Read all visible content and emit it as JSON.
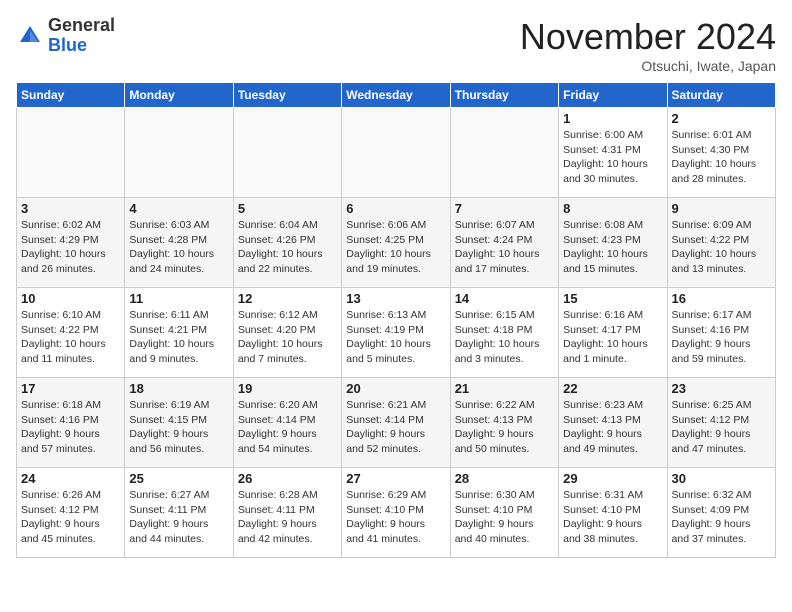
{
  "header": {
    "logo_general": "General",
    "logo_blue": "Blue",
    "month_title": "November 2024",
    "location": "Otsuchi, Iwate, Japan"
  },
  "weekdays": [
    "Sunday",
    "Monday",
    "Tuesday",
    "Wednesday",
    "Thursday",
    "Friday",
    "Saturday"
  ],
  "weeks": [
    [
      {
        "day": "",
        "info": ""
      },
      {
        "day": "",
        "info": ""
      },
      {
        "day": "",
        "info": ""
      },
      {
        "day": "",
        "info": ""
      },
      {
        "day": "",
        "info": ""
      },
      {
        "day": "1",
        "info": "Sunrise: 6:00 AM\nSunset: 4:31 PM\nDaylight: 10 hours\nand 30 minutes."
      },
      {
        "day": "2",
        "info": "Sunrise: 6:01 AM\nSunset: 4:30 PM\nDaylight: 10 hours\nand 28 minutes."
      }
    ],
    [
      {
        "day": "3",
        "info": "Sunrise: 6:02 AM\nSunset: 4:29 PM\nDaylight: 10 hours\nand 26 minutes."
      },
      {
        "day": "4",
        "info": "Sunrise: 6:03 AM\nSunset: 4:28 PM\nDaylight: 10 hours\nand 24 minutes."
      },
      {
        "day": "5",
        "info": "Sunrise: 6:04 AM\nSunset: 4:26 PM\nDaylight: 10 hours\nand 22 minutes."
      },
      {
        "day": "6",
        "info": "Sunrise: 6:06 AM\nSunset: 4:25 PM\nDaylight: 10 hours\nand 19 minutes."
      },
      {
        "day": "7",
        "info": "Sunrise: 6:07 AM\nSunset: 4:24 PM\nDaylight: 10 hours\nand 17 minutes."
      },
      {
        "day": "8",
        "info": "Sunrise: 6:08 AM\nSunset: 4:23 PM\nDaylight: 10 hours\nand 15 minutes."
      },
      {
        "day": "9",
        "info": "Sunrise: 6:09 AM\nSunset: 4:22 PM\nDaylight: 10 hours\nand 13 minutes."
      }
    ],
    [
      {
        "day": "10",
        "info": "Sunrise: 6:10 AM\nSunset: 4:22 PM\nDaylight: 10 hours\nand 11 minutes."
      },
      {
        "day": "11",
        "info": "Sunrise: 6:11 AM\nSunset: 4:21 PM\nDaylight: 10 hours\nand 9 minutes."
      },
      {
        "day": "12",
        "info": "Sunrise: 6:12 AM\nSunset: 4:20 PM\nDaylight: 10 hours\nand 7 minutes."
      },
      {
        "day": "13",
        "info": "Sunrise: 6:13 AM\nSunset: 4:19 PM\nDaylight: 10 hours\nand 5 minutes."
      },
      {
        "day": "14",
        "info": "Sunrise: 6:15 AM\nSunset: 4:18 PM\nDaylight: 10 hours\nand 3 minutes."
      },
      {
        "day": "15",
        "info": "Sunrise: 6:16 AM\nSunset: 4:17 PM\nDaylight: 10 hours\nand 1 minute."
      },
      {
        "day": "16",
        "info": "Sunrise: 6:17 AM\nSunset: 4:16 PM\nDaylight: 9 hours\nand 59 minutes."
      }
    ],
    [
      {
        "day": "17",
        "info": "Sunrise: 6:18 AM\nSunset: 4:16 PM\nDaylight: 9 hours\nand 57 minutes."
      },
      {
        "day": "18",
        "info": "Sunrise: 6:19 AM\nSunset: 4:15 PM\nDaylight: 9 hours\nand 56 minutes."
      },
      {
        "day": "19",
        "info": "Sunrise: 6:20 AM\nSunset: 4:14 PM\nDaylight: 9 hours\nand 54 minutes."
      },
      {
        "day": "20",
        "info": "Sunrise: 6:21 AM\nSunset: 4:14 PM\nDaylight: 9 hours\nand 52 minutes."
      },
      {
        "day": "21",
        "info": "Sunrise: 6:22 AM\nSunset: 4:13 PM\nDaylight: 9 hours\nand 50 minutes."
      },
      {
        "day": "22",
        "info": "Sunrise: 6:23 AM\nSunset: 4:13 PM\nDaylight: 9 hours\nand 49 minutes."
      },
      {
        "day": "23",
        "info": "Sunrise: 6:25 AM\nSunset: 4:12 PM\nDaylight: 9 hours\nand 47 minutes."
      }
    ],
    [
      {
        "day": "24",
        "info": "Sunrise: 6:26 AM\nSunset: 4:12 PM\nDaylight: 9 hours\nand 45 minutes."
      },
      {
        "day": "25",
        "info": "Sunrise: 6:27 AM\nSunset: 4:11 PM\nDaylight: 9 hours\nand 44 minutes."
      },
      {
        "day": "26",
        "info": "Sunrise: 6:28 AM\nSunset: 4:11 PM\nDaylight: 9 hours\nand 42 minutes."
      },
      {
        "day": "27",
        "info": "Sunrise: 6:29 AM\nSunset: 4:10 PM\nDaylight: 9 hours\nand 41 minutes."
      },
      {
        "day": "28",
        "info": "Sunrise: 6:30 AM\nSunset: 4:10 PM\nDaylight: 9 hours\nand 40 minutes."
      },
      {
        "day": "29",
        "info": "Sunrise: 6:31 AM\nSunset: 4:10 PM\nDaylight: 9 hours\nand 38 minutes."
      },
      {
        "day": "30",
        "info": "Sunrise: 6:32 AM\nSunset: 4:09 PM\nDaylight: 9 hours\nand 37 minutes."
      }
    ]
  ]
}
